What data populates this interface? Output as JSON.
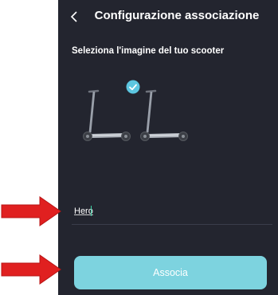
{
  "header": {
    "title": "Configurazione associazione",
    "back_icon": "chevron-left-icon"
  },
  "main": {
    "prompt": "Seleziona l'imagine del tuo scooter",
    "scooters": [
      {
        "selected": false
      },
      {
        "selected": true
      }
    ],
    "name_input": {
      "value": "Hero"
    },
    "associate_button": {
      "label": "Associa"
    }
  },
  "colors": {
    "background": "#23252f",
    "accent": "#7dd3df",
    "check": "#5cc6e0",
    "annotation_arrow": "#e02020"
  }
}
